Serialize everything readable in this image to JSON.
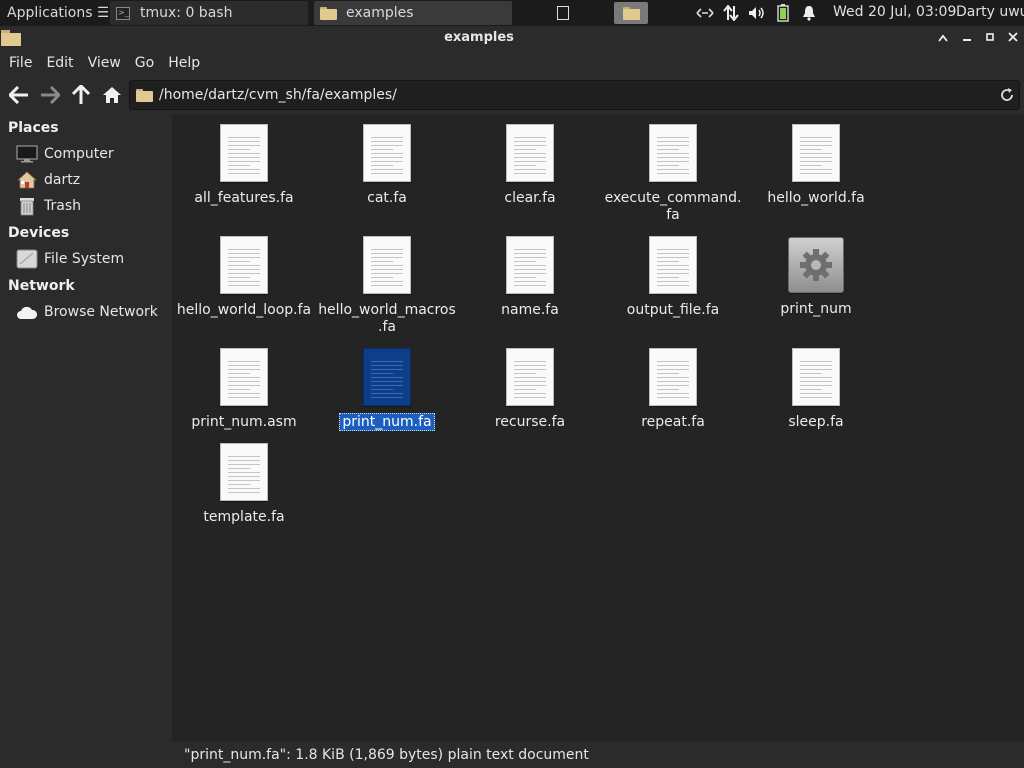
{
  "panel": {
    "app_menu_label": "Applications ☰",
    "tasks": [
      {
        "label": "tmux: 0 bash"
      },
      {
        "label": "examples"
      }
    ],
    "clock": "Wed 20 Jul, 03:09",
    "user": "Darty uwu"
  },
  "window": {
    "title": "examples"
  },
  "menubar": {
    "items": [
      "File",
      "Edit",
      "View",
      "Go",
      "Help"
    ]
  },
  "toolbar": {
    "location": "/home/dartz/cvm_sh/fa/examples/"
  },
  "sidebar": {
    "places_heading": "Places",
    "places": [
      "Computer",
      "dartz",
      "Trash"
    ],
    "devices_heading": "Devices",
    "devices": [
      "File System"
    ],
    "network_heading": "Network",
    "network": [
      "Browse Network"
    ]
  },
  "files": [
    {
      "name": "all_features.fa",
      "kind": "text"
    },
    {
      "name": "cat.fa",
      "kind": "text"
    },
    {
      "name": "clear.fa",
      "kind": "text"
    },
    {
      "name": "execute_command.\nfa",
      "kind": "text"
    },
    {
      "name": "hello_world.fa",
      "kind": "text"
    },
    {
      "name": "hello_world_loop.fa",
      "kind": "text"
    },
    {
      "name": "hello_world_macros\n.fa",
      "kind": "text"
    },
    {
      "name": "name.fa",
      "kind": "text"
    },
    {
      "name": "output_file.fa",
      "kind": "text"
    },
    {
      "name": "print_num",
      "kind": "executable"
    },
    {
      "name": "print_num.asm",
      "kind": "text"
    },
    {
      "name": "print_num.fa",
      "kind": "text",
      "selected": true
    },
    {
      "name": "recurse.fa",
      "kind": "text"
    },
    {
      "name": "repeat.fa",
      "kind": "text"
    },
    {
      "name": "sleep.fa",
      "kind": "text"
    },
    {
      "name": "template.fa",
      "kind": "text"
    }
  ],
  "statusbar": {
    "text": "\"print_num.fa\": 1.8 KiB (1,869 bytes) plain text document"
  },
  "colors": {
    "selection": "#1c5fbf",
    "panel": "#1b1b1b",
    "background": "#242424"
  }
}
